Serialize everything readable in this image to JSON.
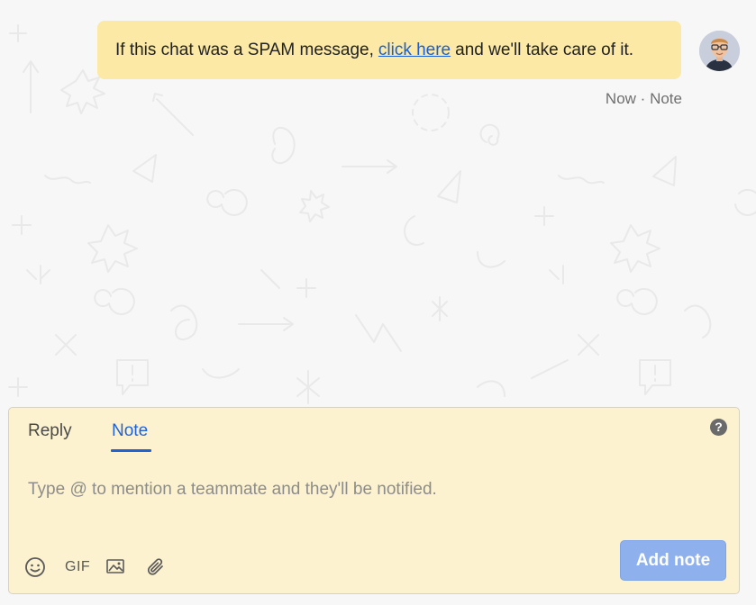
{
  "message": {
    "text_before": "If this chat was a SPAM message,",
    "link_text": "click here",
    "text_after": "and we'll take care of it.",
    "time": "Now",
    "separator": "·",
    "type": "Note"
  },
  "composer": {
    "tabs": [
      {
        "label": "Reply",
        "active": false
      },
      {
        "label": "Note",
        "active": true
      }
    ],
    "help_icon": "?",
    "placeholder": "Type @ to mention a teammate and they'll be notified.",
    "value": "",
    "toolbar": {
      "emoji_icon": "smiley-icon",
      "gif_label": "GIF",
      "image_icon": "image-icon",
      "attach_icon": "paperclip-icon"
    },
    "submit_label": "Add note"
  },
  "colors": {
    "note_background": "#fbe9a5",
    "composer_background": "#fdf2cf",
    "accent": "#1f63d8",
    "button": "#8eb0ec"
  }
}
